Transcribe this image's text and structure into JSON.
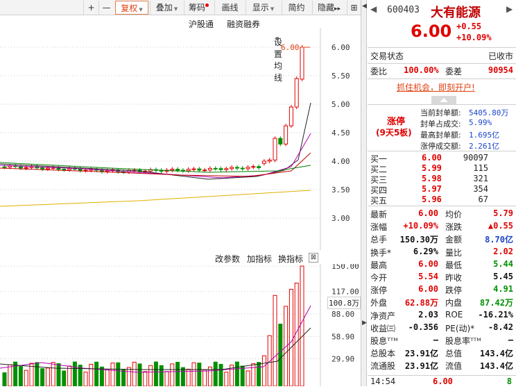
{
  "toolbar": {
    "add": "+",
    "minus": "—",
    "fuquan": "复权",
    "diejia": "叠加",
    "chouma": "筹码",
    "huaxian": "画线",
    "xianshi": "显示",
    "jianyue": "简约",
    "yincang": "隐藏",
    "more": "▸▸",
    "expand": "⊞"
  },
  "chart_header": {
    "hgt": "沪股通",
    "rzrq": "融资融券",
    "ma_settings": "设置均线"
  },
  "chart": {
    "y_labels": [
      "6.00",
      "5.50",
      "5.00",
      "4.50",
      "4.00",
      "3.50",
      "3.00"
    ],
    "max_label": "6.00",
    "colors": {
      "up": "#e00000",
      "down": "#009000",
      "ma5": "#222222",
      "ma10": "#b000b0",
      "ma20": "#c00000",
      "ma60": "#008000",
      "ma250": "#e0b000"
    }
  },
  "vol_header": {
    "params": "改参数",
    "add_ind": "加指标",
    "switch_ind": "换指标",
    "close": "⊠"
  },
  "vol_chart": {
    "y_labels": [
      "150.00",
      "117.00",
      "88.00",
      "58.90",
      "29.90"
    ],
    "marker": "100.8万"
  },
  "stock": {
    "code": "600403",
    "name": "大有能源",
    "price": "6.00",
    "change": "+0.55",
    "change_pct": "+10.09%"
  },
  "status": {
    "label": "交易状态",
    "value": "已收市"
  },
  "weibi": {
    "label1": "委比",
    "value1": "100.00%",
    "label2": "委差",
    "value2": "90954"
  },
  "promo": "抓住机会，即刻开户!",
  "limit_up": {
    "title": "涨停",
    "subtitle": "(9天5板)",
    "rows": [
      {
        "label": "当前封单额:",
        "value": "5405.80万"
      },
      {
        "label": "封单占成交:",
        "value": "5.99%"
      },
      {
        "label": "最高封单额:",
        "value": "1.695亿"
      },
      {
        "label": "涨停成交额:",
        "value": "2.261亿"
      }
    ]
  },
  "buy_book": [
    {
      "label": "买一",
      "price": "6.00",
      "vol": "90097"
    },
    {
      "label": "买二",
      "price": "5.99",
      "vol": "115"
    },
    {
      "label": "买三",
      "price": "5.98",
      "vol": "321"
    },
    {
      "label": "买四",
      "price": "5.97",
      "vol": "354"
    },
    {
      "label": "买五",
      "price": "5.96",
      "vol": "67"
    }
  ],
  "quote": {
    "zuixin": {
      "l": "最新",
      "v": "6.00"
    },
    "junjia": {
      "l": "均价",
      "v": "5.79"
    },
    "zhangfu": {
      "l": "涨幅",
      "v": "+10.09%"
    },
    "zhangdie": {
      "l": "涨跌",
      "v": "▲0.55"
    },
    "zongshou": {
      "l": "总手",
      "v": "150.30万"
    },
    "jine": {
      "l": "金额",
      "v": "8.70亿"
    },
    "huanshou": {
      "l": "换手*",
      "v": "6.29%"
    },
    "liangbi": {
      "l": "量比",
      "v": "2.02"
    },
    "zuigao": {
      "l": "最高",
      "v": "6.00"
    },
    "zuidi": {
      "l": "最低",
      "v": "5.44"
    },
    "jinkai": {
      "l": "今开",
      "v": "5.54"
    },
    "zuoshou": {
      "l": "昨收",
      "v": "5.45"
    },
    "zhangting": {
      "l": "涨停",
      "v": "6.00"
    },
    "dieting": {
      "l": "跌停",
      "v": "4.91"
    },
    "waipan": {
      "l": "外盘",
      "v": "62.88万"
    },
    "neipan": {
      "l": "内盘",
      "v": "87.42万"
    },
    "jingzichan": {
      "l": "净资产",
      "v": "2.03"
    },
    "roe": {
      "l": "ROE",
      "v": "-16.21%"
    },
    "shouyi": {
      "l": "收益㈢",
      "v": "-0.356"
    },
    "pe": {
      "l": "PE(动)*",
      "v": "-8.42"
    },
    "guxi": {
      "l": "股息ᵀᵀᴹ",
      "v": "—"
    },
    "guxilv": {
      "l": "股息率ᵀᵀᴹ",
      "v": "—"
    },
    "zongguben": {
      "l": "总股本",
      "v": "23.91亿"
    },
    "zongzhi": {
      "l": "总值",
      "v": "143.4亿"
    },
    "liutonggu": {
      "l": "流通股",
      "v": "23.91亿"
    },
    "liutongzhi": {
      "l": "流值",
      "v": "143.4亿"
    }
  },
  "tick": {
    "time": "14:54",
    "price": "6.00",
    "vol": "8"
  }
}
